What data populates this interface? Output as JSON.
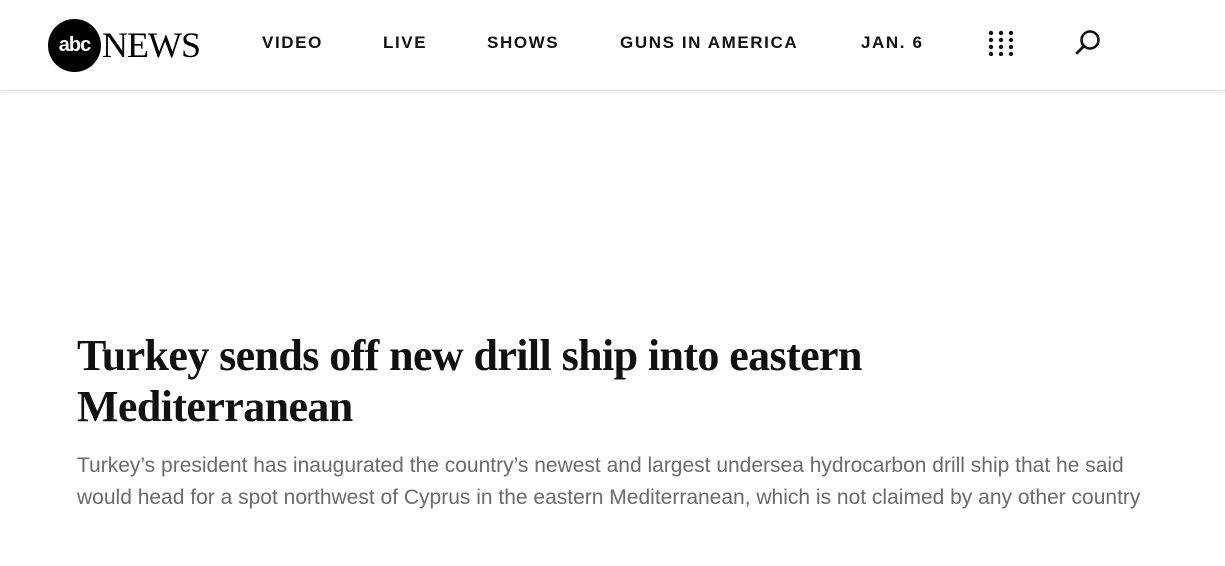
{
  "header": {
    "logo": {
      "circle_text": "abc",
      "word_text": "NEWS"
    },
    "nav": {
      "items": [
        {
          "label": "VIDEO"
        },
        {
          "label": "LIVE"
        },
        {
          "label": "SHOWS"
        },
        {
          "label": "GUNS IN AMERICA"
        },
        {
          "label": "JAN. 6"
        }
      ]
    },
    "icons": {
      "menu": "grid-dots-icon",
      "search": "search-icon"
    }
  },
  "article": {
    "headline": "Turkey sends off new drill ship into eastern Mediterranean",
    "dek": "Turkey’s president has inaugurated the country’s newest and largest undersea hydrocarbon drill ship that he said would head for a spot northwest of Cyprus in the eastern Mediterranean, which is not claimed by any other country"
  },
  "colors": {
    "header_background": "#ffffff",
    "text_primary": "#111111",
    "text_secondary": "#6b6b6b",
    "logo_circle": "#000000"
  }
}
